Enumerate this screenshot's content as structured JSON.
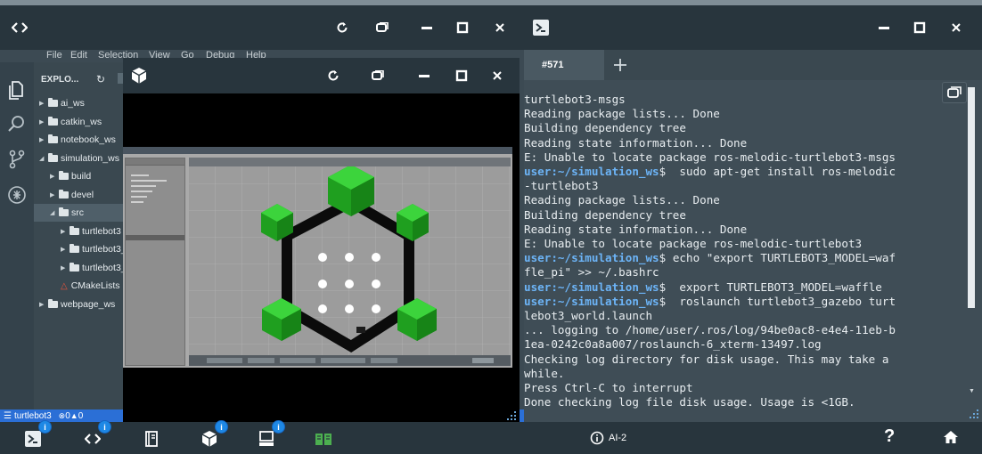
{
  "ide": {
    "menu": [
      "File",
      "Edit",
      "Selection",
      "View",
      "Go",
      "Debug",
      "Help"
    ],
    "explorer_title": "EXPLO...",
    "tree": [
      {
        "label": "ai_ws",
        "indent": 0,
        "kind": "folder",
        "open": false
      },
      {
        "label": "catkin_ws",
        "indent": 0,
        "kind": "folder",
        "open": false
      },
      {
        "label": "notebook_ws",
        "indent": 0,
        "kind": "folder",
        "open": false
      },
      {
        "label": "simulation_ws",
        "indent": 0,
        "kind": "folder",
        "open": true
      },
      {
        "label": "build",
        "indent": 1,
        "kind": "folder",
        "open": false
      },
      {
        "label": "devel",
        "indent": 1,
        "kind": "folder",
        "open": false
      },
      {
        "label": "src",
        "indent": 1,
        "kind": "folder",
        "open": true
      },
      {
        "label": "turtlebot3",
        "indent": 2,
        "kind": "folder",
        "open": false
      },
      {
        "label": "turtlebot3_",
        "indent": 2,
        "kind": "folder",
        "open": false
      },
      {
        "label": "turtlebot3_",
        "indent": 2,
        "kind": "folder",
        "open": false
      },
      {
        "label": "CMakeLists",
        "indent": 2,
        "kind": "file",
        "open": false
      },
      {
        "label": "webpage_ws",
        "indent": 0,
        "kind": "folder",
        "open": false
      }
    ],
    "status": {
      "branch": "turtlebot3",
      "errors": "0",
      "warnings": "0"
    }
  },
  "terminal": {
    "tab_label": "#571",
    "lines": [
      {
        "t": "turtlebot3-msgs"
      },
      {
        "t": "Reading package lists... Done"
      },
      {
        "t": "Building dependency tree"
      },
      {
        "t": "Reading state information... Done"
      },
      {
        "t": "E: Unable to locate package ros-melodic-turtlebot3-msgs"
      },
      {
        "u": "user:~/simulation_ws",
        "t": "$  sudo apt-get install ros-melodic"
      },
      {
        "t": "-turtlebot3"
      },
      {
        "t": "Reading package lists... Done"
      },
      {
        "t": "Building dependency tree"
      },
      {
        "t": "Reading state information... Done"
      },
      {
        "t": "E: Unable to locate package ros-melodic-turtlebot3"
      },
      {
        "u": "user:~/simulation_ws",
        "t": "$ echo \"export TURTLEBOT3_MODEL=waf"
      },
      {
        "t": "fle_pi\" >> ~/.bashrc"
      },
      {
        "u": "user:~/simulation_ws",
        "t": "$  export TURTLEBOT3_MODEL=waffle"
      },
      {
        "u": "user:~/simulation_ws",
        "t": "$  roslaunch turtlebot3_gazebo turt"
      },
      {
        "t": "lebot3_world.launch"
      },
      {
        "t": "... logging to /home/user/.ros/log/94be0ac8-e4e4-11eb-b"
      },
      {
        "t": "1ea-0242c0a8a007/roslaunch-6_xterm-13497.log"
      },
      {
        "t": "Checking log directory for disk usage. This may take a"
      },
      {
        "t": "while."
      },
      {
        "t": "Press Ctrl-C to interrupt"
      },
      {
        "t": "Done checking log file disk usage. Usage is <1GB."
      }
    ]
  },
  "dock": {
    "center_label": "AI-2",
    "badges": [
      "i",
      "i",
      "i",
      "i"
    ],
    "help_label": "?"
  },
  "colors": {
    "titlebar": "#28353d",
    "terminal_bg": "#3f4d56",
    "prompt": "#6cb4f7",
    "status_bar": "#2b6fd6",
    "cube_green": "#21b021"
  }
}
